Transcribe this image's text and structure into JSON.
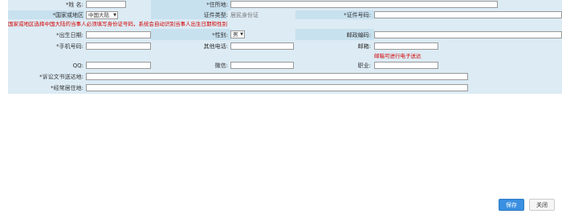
{
  "labels": {
    "name": "*姓 名:",
    "address": "*住所地:",
    "country": "*国家或地区",
    "id_type": "证件类型:",
    "id_number": "*证件号码:",
    "birth": "*出生日期:",
    "gender": "*性别:",
    "postcode": "邮政编码:",
    "mobile": "*手机号码:",
    "other_phone": "其他电话:",
    "email": "邮箱:",
    "qq": "QQ:",
    "wechat": "微信:",
    "job": "职业:",
    "service_addr": "*诉讼文书送达地:",
    "residence": "*经常居住地:"
  },
  "values": {
    "country_selected": "中国大陆",
    "id_type_value": "居民身份证",
    "gender_selected": "男"
  },
  "notes": {
    "country_hint": "国家或地区选择中国大陆的当事人必须填写身份证号码，系统会自动识别当事人出生日期和性别",
    "email_hint": "邮箱可进行电子送达"
  },
  "buttons": {
    "save": "保存",
    "close": "关闭"
  }
}
